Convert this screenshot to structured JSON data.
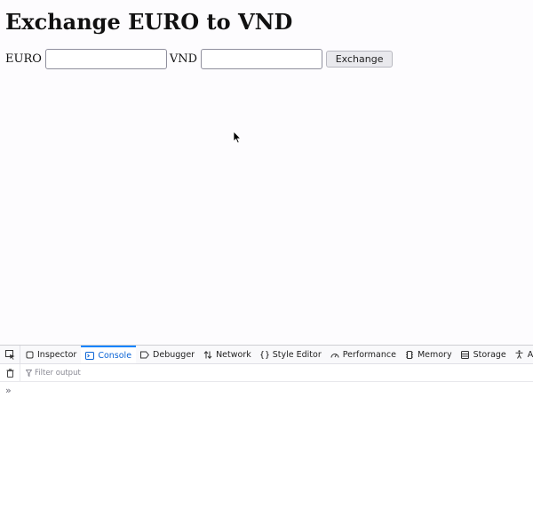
{
  "page": {
    "title": "Exchange EURO to VND"
  },
  "form": {
    "euro_label": "EURO",
    "euro_value": "",
    "vnd_label": "VND",
    "vnd_value": "",
    "exchange_button": "Exchange"
  },
  "devtools": {
    "tabs": [
      {
        "label": "Inspector",
        "icon": "inspector-icon"
      },
      {
        "label": "Console",
        "icon": "console-icon",
        "active": true
      },
      {
        "label": "Debugger",
        "icon": "debugger-icon"
      },
      {
        "label": "Network",
        "icon": "network-icon"
      },
      {
        "label": "Style Editor",
        "icon": "style-editor-icon"
      },
      {
        "label": "Performance",
        "icon": "performance-icon"
      },
      {
        "label": "Memory",
        "icon": "memory-icon"
      },
      {
        "label": "Storage",
        "icon": "storage-icon"
      },
      {
        "label": "Accessibility",
        "icon": "accessibility-icon"
      }
    ],
    "filter_placeholder": "Filter output",
    "prompt_glyph": "»"
  },
  "colors": {
    "active_tab": "#0b64d6",
    "page_background": "#fdfcfe"
  }
}
